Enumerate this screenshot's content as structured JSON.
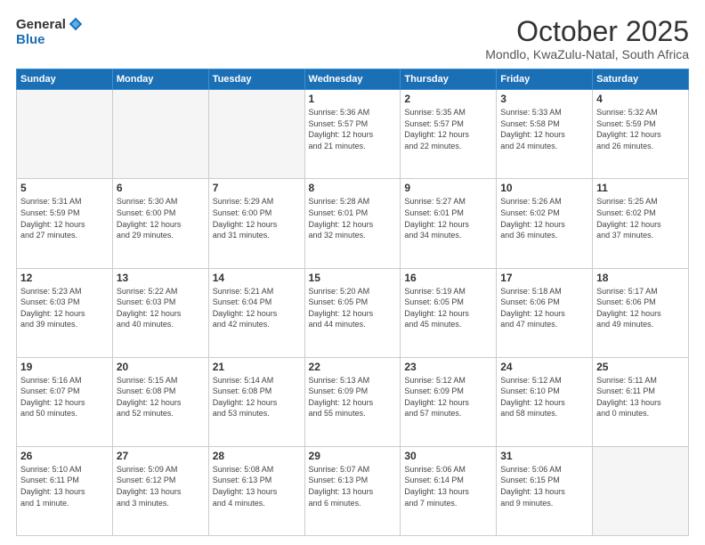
{
  "logo": {
    "general": "General",
    "blue": "Blue"
  },
  "header": {
    "month": "October 2025",
    "location": "Mondlo, KwaZulu-Natal, South Africa"
  },
  "weekdays": [
    "Sunday",
    "Monday",
    "Tuesday",
    "Wednesday",
    "Thursday",
    "Friday",
    "Saturday"
  ],
  "weeks": [
    [
      {
        "day": "",
        "info": ""
      },
      {
        "day": "",
        "info": ""
      },
      {
        "day": "",
        "info": ""
      },
      {
        "day": "1",
        "info": "Sunrise: 5:36 AM\nSunset: 5:57 PM\nDaylight: 12 hours\nand 21 minutes."
      },
      {
        "day": "2",
        "info": "Sunrise: 5:35 AM\nSunset: 5:57 PM\nDaylight: 12 hours\nand 22 minutes."
      },
      {
        "day": "3",
        "info": "Sunrise: 5:33 AM\nSunset: 5:58 PM\nDaylight: 12 hours\nand 24 minutes."
      },
      {
        "day": "4",
        "info": "Sunrise: 5:32 AM\nSunset: 5:59 PM\nDaylight: 12 hours\nand 26 minutes."
      }
    ],
    [
      {
        "day": "5",
        "info": "Sunrise: 5:31 AM\nSunset: 5:59 PM\nDaylight: 12 hours\nand 27 minutes."
      },
      {
        "day": "6",
        "info": "Sunrise: 5:30 AM\nSunset: 6:00 PM\nDaylight: 12 hours\nand 29 minutes."
      },
      {
        "day": "7",
        "info": "Sunrise: 5:29 AM\nSunset: 6:00 PM\nDaylight: 12 hours\nand 31 minutes."
      },
      {
        "day": "8",
        "info": "Sunrise: 5:28 AM\nSunset: 6:01 PM\nDaylight: 12 hours\nand 32 minutes."
      },
      {
        "day": "9",
        "info": "Sunrise: 5:27 AM\nSunset: 6:01 PM\nDaylight: 12 hours\nand 34 minutes."
      },
      {
        "day": "10",
        "info": "Sunrise: 5:26 AM\nSunset: 6:02 PM\nDaylight: 12 hours\nand 36 minutes."
      },
      {
        "day": "11",
        "info": "Sunrise: 5:25 AM\nSunset: 6:02 PM\nDaylight: 12 hours\nand 37 minutes."
      }
    ],
    [
      {
        "day": "12",
        "info": "Sunrise: 5:23 AM\nSunset: 6:03 PM\nDaylight: 12 hours\nand 39 minutes."
      },
      {
        "day": "13",
        "info": "Sunrise: 5:22 AM\nSunset: 6:03 PM\nDaylight: 12 hours\nand 40 minutes."
      },
      {
        "day": "14",
        "info": "Sunrise: 5:21 AM\nSunset: 6:04 PM\nDaylight: 12 hours\nand 42 minutes."
      },
      {
        "day": "15",
        "info": "Sunrise: 5:20 AM\nSunset: 6:05 PM\nDaylight: 12 hours\nand 44 minutes."
      },
      {
        "day": "16",
        "info": "Sunrise: 5:19 AM\nSunset: 6:05 PM\nDaylight: 12 hours\nand 45 minutes."
      },
      {
        "day": "17",
        "info": "Sunrise: 5:18 AM\nSunset: 6:06 PM\nDaylight: 12 hours\nand 47 minutes."
      },
      {
        "day": "18",
        "info": "Sunrise: 5:17 AM\nSunset: 6:06 PM\nDaylight: 12 hours\nand 49 minutes."
      }
    ],
    [
      {
        "day": "19",
        "info": "Sunrise: 5:16 AM\nSunset: 6:07 PM\nDaylight: 12 hours\nand 50 minutes."
      },
      {
        "day": "20",
        "info": "Sunrise: 5:15 AM\nSunset: 6:08 PM\nDaylight: 12 hours\nand 52 minutes."
      },
      {
        "day": "21",
        "info": "Sunrise: 5:14 AM\nSunset: 6:08 PM\nDaylight: 12 hours\nand 53 minutes."
      },
      {
        "day": "22",
        "info": "Sunrise: 5:13 AM\nSunset: 6:09 PM\nDaylight: 12 hours\nand 55 minutes."
      },
      {
        "day": "23",
        "info": "Sunrise: 5:12 AM\nSunset: 6:09 PM\nDaylight: 12 hours\nand 57 minutes."
      },
      {
        "day": "24",
        "info": "Sunrise: 5:12 AM\nSunset: 6:10 PM\nDaylight: 12 hours\nand 58 minutes."
      },
      {
        "day": "25",
        "info": "Sunrise: 5:11 AM\nSunset: 6:11 PM\nDaylight: 13 hours\nand 0 minutes."
      }
    ],
    [
      {
        "day": "26",
        "info": "Sunrise: 5:10 AM\nSunset: 6:11 PM\nDaylight: 13 hours\nand 1 minute."
      },
      {
        "day": "27",
        "info": "Sunrise: 5:09 AM\nSunset: 6:12 PM\nDaylight: 13 hours\nand 3 minutes."
      },
      {
        "day": "28",
        "info": "Sunrise: 5:08 AM\nSunset: 6:13 PM\nDaylight: 13 hours\nand 4 minutes."
      },
      {
        "day": "29",
        "info": "Sunrise: 5:07 AM\nSunset: 6:13 PM\nDaylight: 13 hours\nand 6 minutes."
      },
      {
        "day": "30",
        "info": "Sunrise: 5:06 AM\nSunset: 6:14 PM\nDaylight: 13 hours\nand 7 minutes."
      },
      {
        "day": "31",
        "info": "Sunrise: 5:06 AM\nSunset: 6:15 PM\nDaylight: 13 hours\nand 9 minutes."
      },
      {
        "day": "",
        "info": ""
      }
    ]
  ]
}
